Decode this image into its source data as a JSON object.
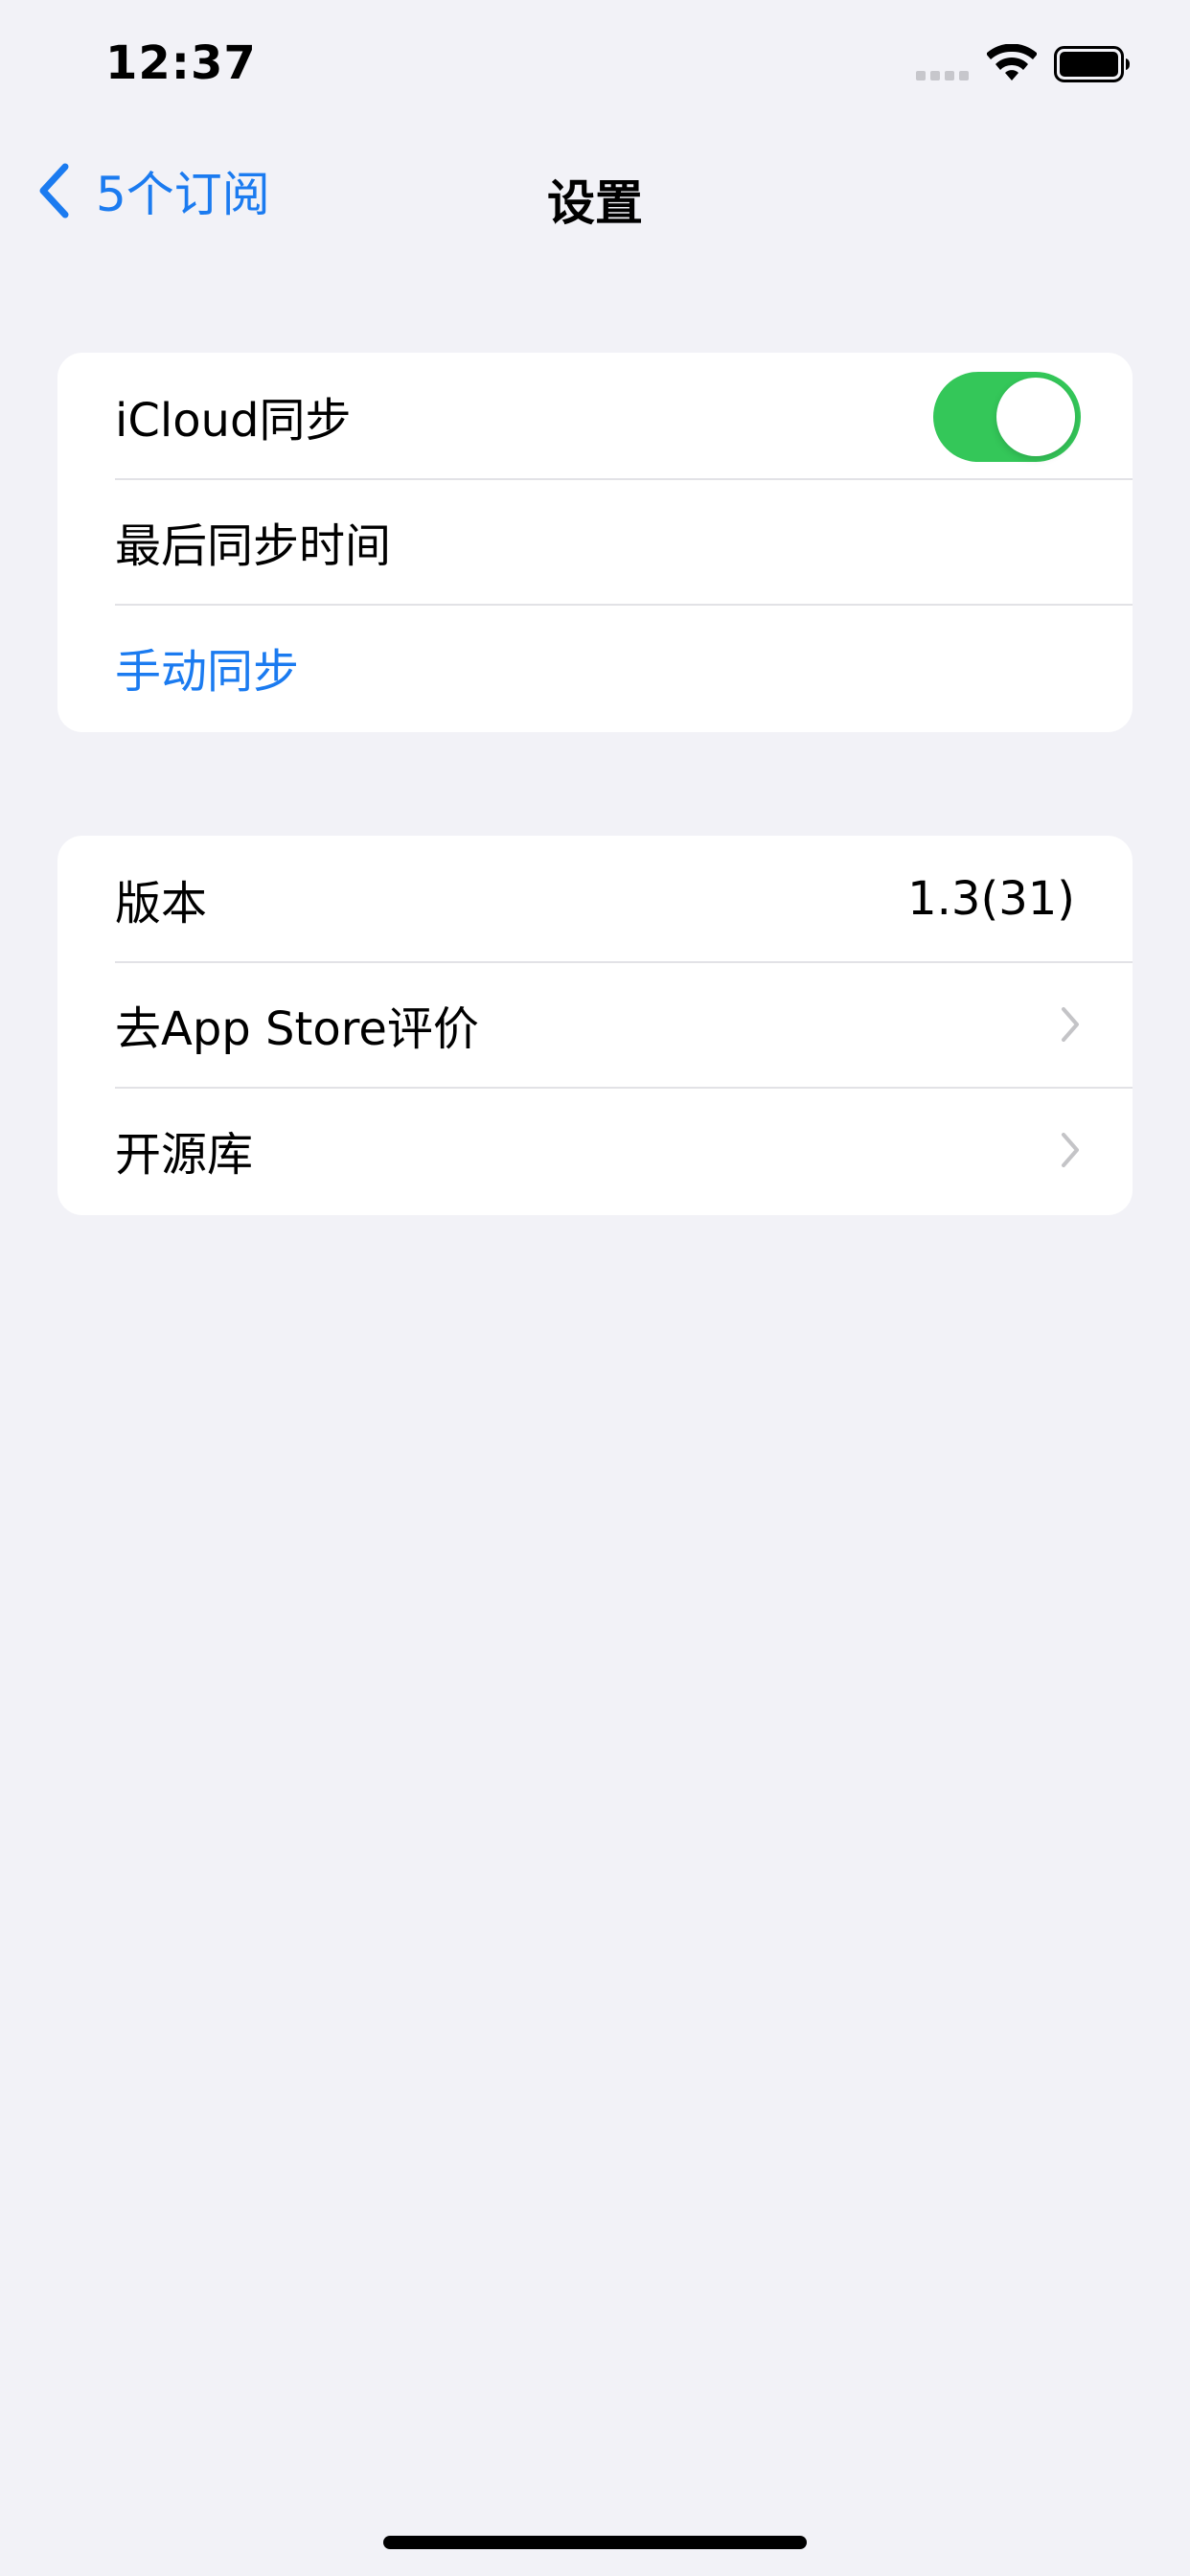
{
  "status_bar": {
    "time": "12:37"
  },
  "nav": {
    "back_label": "5个订阅",
    "title": "设置"
  },
  "groups": [
    {
      "rows": [
        {
          "label": "iCloud同步",
          "toggle_on": true
        },
        {
          "label": "最后同步时间"
        },
        {
          "label": "手动同步"
        }
      ]
    },
    {
      "rows": [
        {
          "label": "版本",
          "value": "1.3(31)"
        },
        {
          "label": "去App Store评价"
        },
        {
          "label": "开源库"
        }
      ]
    }
  ],
  "colors": {
    "accent": "#1B7BF0",
    "toggle_on": "#34C759",
    "background": "#F2F2F7",
    "chevron": "#C4C4C7"
  },
  "icons": {
    "back": "chevron-left-icon",
    "row_chevron": "chevron-right-icon",
    "wifi": "wifi-icon",
    "battery": "battery-icon"
  }
}
